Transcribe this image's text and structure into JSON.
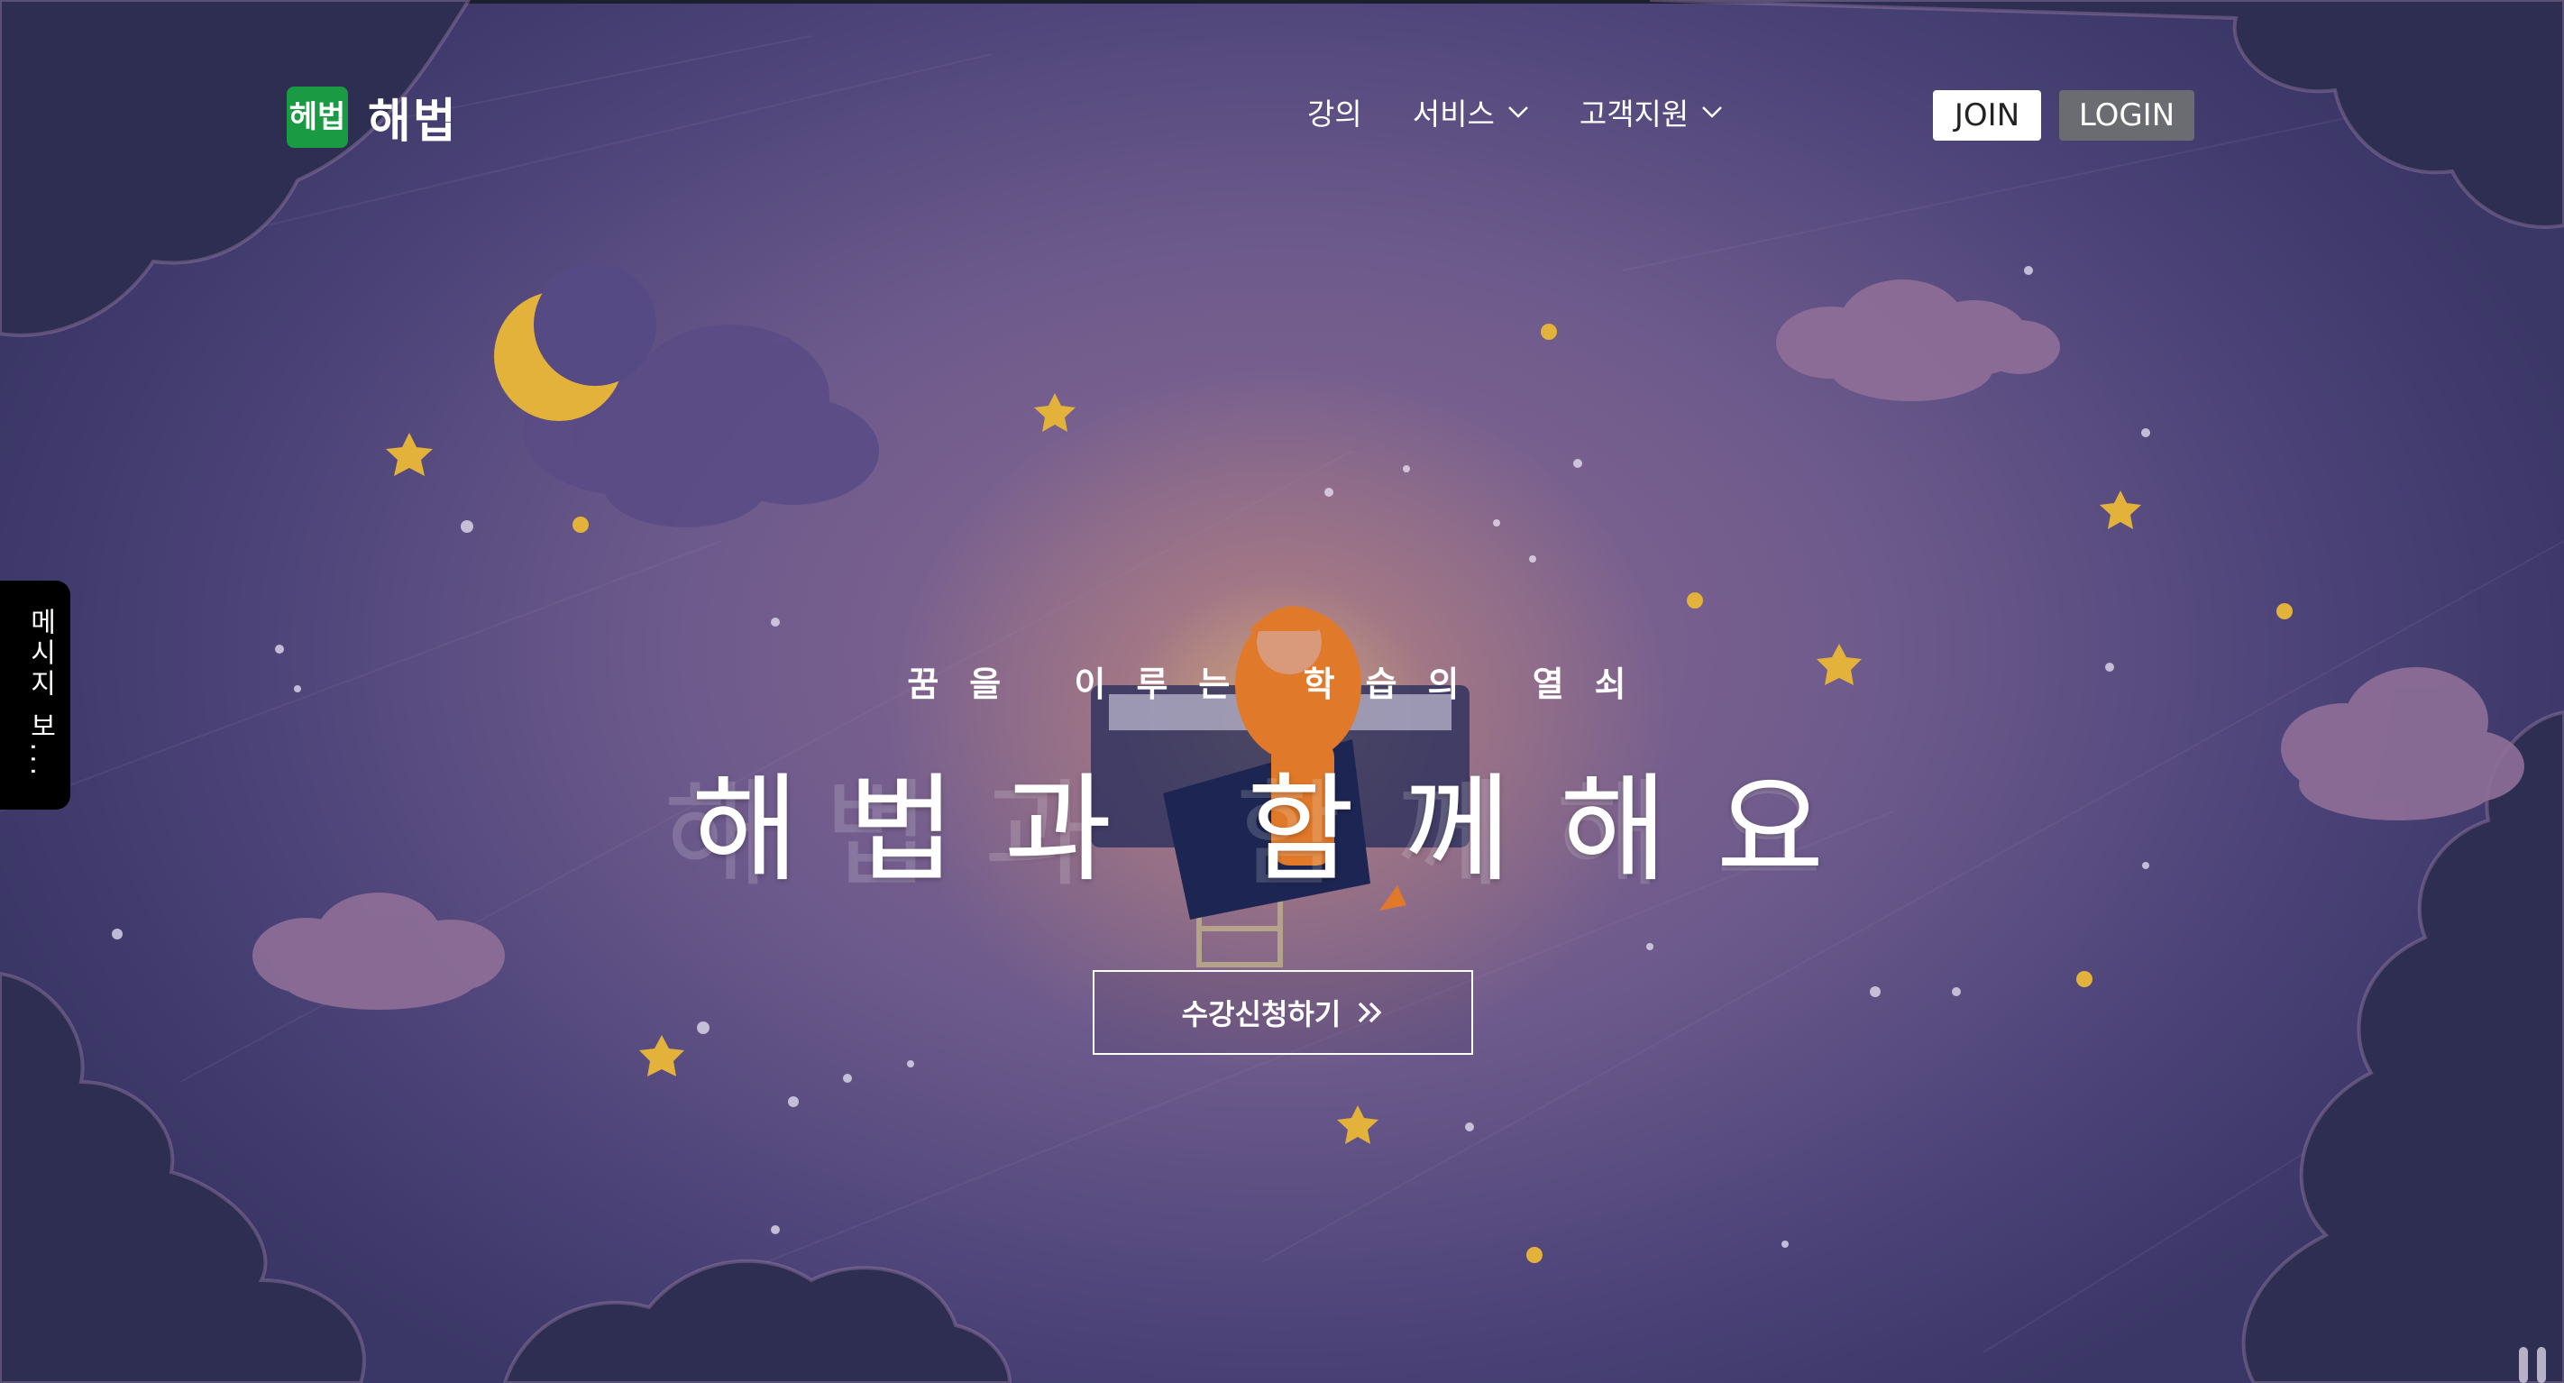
{
  "brand": {
    "logo_mark": "헤법",
    "name": "해법"
  },
  "nav": {
    "items": [
      {
        "label": "강의",
        "has_dropdown": false
      },
      {
        "label": "서비스",
        "has_dropdown": true,
        "icon": "chevron-down-icon"
      },
      {
        "label": "고객지원",
        "has_dropdown": true,
        "icon": "chevron-down-icon"
      }
    ],
    "join_label": "JOIN",
    "login_label": "LOGIN"
  },
  "side_tab": {
    "label": "메시지 보..."
  },
  "hero": {
    "tagline": "꿈을 이루는 학습의 열쇠",
    "headline": "해법과 함께해요",
    "cta_label": "수강신청하기",
    "cta_icon": "double-chevron-right-icon"
  },
  "colors": {
    "logo_green": "#1a9a43",
    "login_bg": "#6b6b72",
    "sky_dark": "#2e2f52",
    "sky_mid": "#6d5a8c",
    "moon": "#e2b23a",
    "pajamas": "#e07a2a"
  }
}
